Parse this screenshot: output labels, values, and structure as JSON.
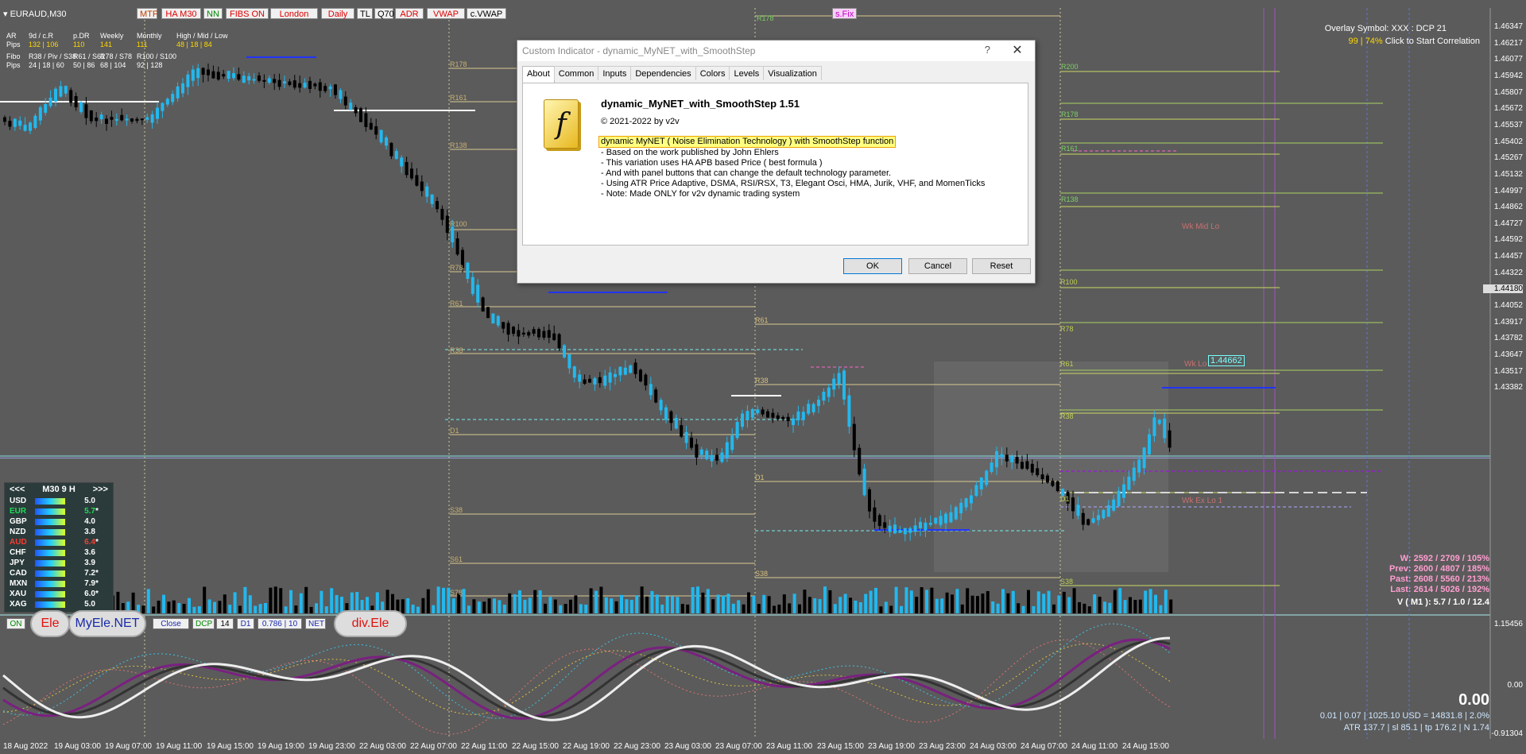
{
  "symbol": "EURAUD,M30",
  "toolbar": {
    "buttons": [
      "MTF",
      "HA M30",
      "NN",
      "FIBS ON",
      "London",
      "Daily",
      "TL",
      "Q70",
      "ADR",
      "VWAP",
      "c.VWAP"
    ],
    "sfix": "s.Fix"
  },
  "stats": {
    "r1": [
      "AR",
      "9d / c.R",
      "p.DR",
      "Weekly",
      "Monthly",
      "High / Mid / Low"
    ],
    "r2": [
      "Pips",
      "132 | 106",
      "110",
      "141",
      "111",
      "48 | 18 | 84"
    ],
    "r3": [
      "Fibo",
      "R38 / Piv / S38",
      "R61 / S61",
      "R78 / S78",
      "R100 / S100"
    ],
    "r4": [
      "Pips",
      "24 | 18 | 60",
      "50 | 86",
      "68 | 104",
      "92 | 128"
    ]
  },
  "overlay": {
    "line1": "Overlay Symbol: XXX : DCP 21",
    "line2a": "99 | 74%",
    "line2b": "Click to Start Correlation"
  },
  "price_axis": [
    "1.46347",
    "1.46217",
    "1.46077",
    "1.45942",
    "1.45807",
    "1.45672",
    "1.45537",
    "1.45402",
    "1.45267",
    "1.45132",
    "1.44997",
    "1.44862",
    "1.44727",
    "1.44592",
    "1.44457",
    "1.44322",
    "1.44180",
    "1.44052",
    "1.43917",
    "1.43782",
    "1.43647",
    "1.43517",
    "1.43382"
  ],
  "sub_axis": [
    "1.15456",
    "0.00",
    "-0.91304"
  ],
  "time_axis": [
    "18 Aug 2022",
    "19 Aug 03:00",
    "19 Aug 07:00",
    "19 Aug 11:00",
    "19 Aug 15:00",
    "19 Aug 19:00",
    "19 Aug 23:00",
    "22 Aug 03:00",
    "22 Aug 07:00",
    "22 Aug 11:00",
    "22 Aug 15:00",
    "22 Aug 19:00",
    "22 Aug 23:00",
    "23 Aug 03:00",
    "23 Aug 07:00",
    "23 Aug 11:00",
    "23 Aug 15:00",
    "23 Aug 19:00",
    "23 Aug 23:00",
    "24 Aug 03:00",
    "24 Aug 07:00",
    "24 Aug 11:00",
    "24 Aug 15:00"
  ],
  "levels": {
    "a": [
      "R178",
      "R161",
      "R138",
      "R100",
      "R78",
      "R61",
      "R38",
      "D1",
      "S38",
      "S61",
      "S78"
    ],
    "b": [
      "R61",
      "R38",
      "D1",
      "S38"
    ],
    "c": [
      "R100",
      "R78",
      "R61",
      "R38",
      "D1",
      "S38"
    ],
    "d": [
      "R200",
      "R178",
      "R161",
      "R138"
    ],
    "top": "R178"
  },
  "annotations": {
    "wk_mid": "Wk Mid Lo",
    "wk_lo": "Wk Lo",
    "wk_price": "1.44662",
    "wk_ex": "Wk Ex Lo 1"
  },
  "currency_panel": {
    "nav_prev": "<<<",
    "period": "M30  9  H",
    "nav_next": ">>>",
    "rows": [
      {
        "name": "USD",
        "val": "5.0",
        "star": "",
        "color": "#ffffff"
      },
      {
        "name": "EUR",
        "val": "5.7",
        "star": "*",
        "color": "#22dd55"
      },
      {
        "name": "GBP",
        "val": "4.0",
        "star": "",
        "color": "#ffffff"
      },
      {
        "name": "NZD",
        "val": "3.8",
        "star": "",
        "color": "#ffffff"
      },
      {
        "name": "AUD",
        "val": "6.4",
        "star": "*",
        "color": "#ff3b30"
      },
      {
        "name": "CHF",
        "val": "3.6",
        "star": "",
        "color": "#ffffff"
      },
      {
        "name": "JPY",
        "val": "3.9",
        "star": "",
        "color": "#ffffff"
      },
      {
        "name": "CAD",
        "val": "7.2",
        "star": "*",
        "color": "#ffffff"
      },
      {
        "name": "MXN",
        "val": "7.9",
        "star": "*",
        "color": "#ffffff"
      },
      {
        "name": "XAU",
        "val": "6.0",
        "star": "*",
        "color": "#ffffff"
      },
      {
        "name": "XAG",
        "val": "5.0",
        "star": "",
        "color": "#ffffff"
      }
    ]
  },
  "bottom_bar": {
    "on": "ON",
    "ele": "Ele",
    "myele": "MyEle.NET",
    "close": "Close",
    "dcp": "DCP",
    "n14": "14",
    "d1": "D1",
    "ratio": "0.786 | 10",
    "net": "NET",
    "divele": "div.Ele"
  },
  "right_stats": {
    "w": "W: 2592 / 2709 / 105%",
    "prev": "Prev: 2600 / 4807 / 185%",
    "past": "Past: 2608 / 5560 / 213%",
    "last": "Last: 2614 / 5026 / 192%",
    "v": "V ( M1 ): 5.7 / 1.0 / 12.4",
    "sub_value": "0.00",
    "sub_line1": "0.01  |  0.07  |  1025.10 USD = 14831.8  |  2.0%",
    "sub_line2": "ATR 137.7  |  sl 85.1  |  tp 176.2  |  N 1.74"
  },
  "dialog": {
    "title": "Custom Indicator - dynamic_MyNET_with_SmoothStep",
    "help": "?",
    "close": "✕",
    "tabs": [
      "About",
      "Common",
      "Inputs",
      "Dependencies",
      "Colors",
      "Levels",
      "Visualization"
    ],
    "icon": "f",
    "name": "dynamic_MyNET_with_SmoothStep 1.51",
    "copyright": "© 2021-2022 by v2v",
    "highlight": "dynamic MyNET ( Noise Elimination Technology ) with SmoothStep function",
    "lines": [
      "- Based on the work published by John Ehlers",
      "- This variation uses HA APB based Price ( best formula )",
      "- And with panel buttons that can change the default technology parameter.",
      "- Using ATR Price Adaptive, DSMA, RSI/RSX, T3, Elegant Osci, HMA, Jurik, VHF, and MomenTicks",
      "- Note: Made ONLY for v2v dynamic trading system"
    ],
    "ok": "OK",
    "cancel": "Cancel",
    "reset": "Reset"
  }
}
